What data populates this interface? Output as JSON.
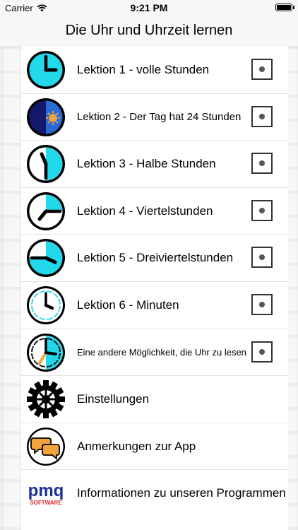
{
  "status_bar": {
    "carrier": "Carrier",
    "time": "9:21 PM"
  },
  "nav": {
    "title": "Die Uhr und Uhrzeit lernen"
  },
  "colors": {
    "cyan": "#22d9ec",
    "navy": "#15196e",
    "orange": "#f2a33a",
    "pmq_blue": "#1a2f9a",
    "pmq_red": "#e0262a"
  },
  "rows": [
    {
      "label": "Lektion 1 - volle Stunden",
      "icon": "clock-full-hour-icon",
      "has_check": true
    },
    {
      "label": "Lektion 2 - Der Tag hat 24 Stunden",
      "icon": "day-night-clock-icon",
      "has_check": true
    },
    {
      "label": "Lektion 3 - Halbe Stunden",
      "icon": "clock-half-hour-icon",
      "has_check": true
    },
    {
      "label": "Lektion 4 - Viertelstunden",
      "icon": "clock-quarter-icon",
      "has_check": true
    },
    {
      "label": "Lektion 5 - Dreiviertelstunden",
      "icon": "clock-three-quarter-icon",
      "has_check": true
    },
    {
      "label": "Lektion 6 - Minuten",
      "icon": "clock-minutes-icon",
      "has_check": true
    },
    {
      "label": "Eine andere Möglichkeit, die Uhr zu lesen",
      "icon": "clock-alternative-icon",
      "has_check": true
    },
    {
      "label": "Einstellungen",
      "icon": "gear-icon",
      "has_check": false
    },
    {
      "label": "Anmerkungen zur App",
      "icon": "speech-bubbles-icon",
      "has_check": false
    },
    {
      "label": "Informationen zu unseren Programmen",
      "icon": "pmq-software-logo",
      "has_check": false
    }
  ],
  "logo": {
    "brand": "pmq",
    "sub": "SOFTWARE"
  }
}
